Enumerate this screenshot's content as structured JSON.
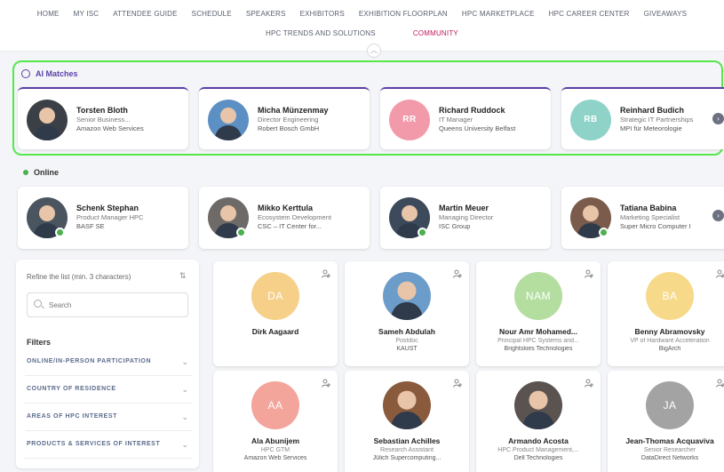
{
  "nav": {
    "row1": [
      "Home",
      "MY ISC",
      "ATTENDEE GUIDE",
      "SCHEDULE",
      "SPEAKERS",
      "EXHIBITORS",
      "EXHIBITION FLOORPLAN",
      "HPC MARKETPLACE",
      "HPC CAREER CENTER",
      "GIVEAWAYS"
    ],
    "row2": [
      "HPC TRENDS AND SOLUTIONS",
      "COMMUNITY"
    ],
    "active": "COMMUNITY",
    "active_color": "#c2185b"
  },
  "ai_matches": {
    "title": "AI Matches",
    "highlight_color": "#55e84b",
    "people": [
      {
        "name": "Torsten Bloth",
        "role": "Senior Business...",
        "org": "Amazon Web Services",
        "initials": "",
        "avatar_color": "#3b3f46",
        "photo": true
      },
      {
        "name": "Micha Münzenmay",
        "role": "Director Engineering",
        "org": "Robert Bosch GmbH",
        "initials": "",
        "avatar_color": "#5c8fc4",
        "photo": true
      },
      {
        "name": "Richard Ruddock",
        "role": "IT Manager",
        "org": "Queens University Belfast",
        "initials": "RR",
        "avatar_color": "#f29aa9",
        "photo": false
      },
      {
        "name": "Reinhard Budich",
        "role": "Strategic IT Partnerships",
        "org": "MPI für Meteorologie",
        "initials": "RB",
        "avatar_color": "#8fd3c8",
        "photo": false
      }
    ]
  },
  "online": {
    "title": "Online",
    "people": [
      {
        "name": "Schenk Stephan",
        "role": "Product Manager HPC",
        "org": "BASF SE",
        "initials": "",
        "avatar_color": "#4a5560",
        "photo": true
      },
      {
        "name": "Mikko Kerttula",
        "role": "Ecosystem Development",
        "org": "CSC – IT Center for...",
        "initials": "",
        "avatar_color": "#6d6a68",
        "photo": true
      },
      {
        "name": "Martin Meuer",
        "role": "Managing Director",
        "org": "ISC Group",
        "initials": "",
        "avatar_color": "#3c4a5c",
        "photo": true
      },
      {
        "name": "Tatiana Babina",
        "role": "Marketing Specialist",
        "org": "Super Micro Computer I",
        "initials": "",
        "avatar_color": "#7a5b4c",
        "photo": true
      }
    ]
  },
  "filters": {
    "refine_label": "Refine the list (min. 3 characters)",
    "search_placeholder": "Search",
    "heading": "Filters",
    "items": [
      "ONLINE/IN-PERSON PARTICIPATION",
      "COUNTRY OF RESIDENCE",
      "AREAS OF HPC INTEREST",
      "PRODUCTS & SERVICES OF INTEREST"
    ]
  },
  "grid": [
    {
      "name": "Dirk Aagaard",
      "role": "",
      "org": "",
      "initials": "DA",
      "avatar_color": "#f6cf88",
      "photo": false
    },
    {
      "name": "Sameh Abdulah",
      "role": "Postdoc",
      "org": "KAUST",
      "initials": "",
      "avatar_color": "#6c9cc9",
      "photo": true
    },
    {
      "name": "Nour Amr Mohamed...",
      "role": "Principal HPC Systems and...",
      "org": "Brightskies Technologies",
      "initials": "NAM",
      "avatar_color": "#b3dea0",
      "photo": false
    },
    {
      "name": "Benny Abramovsky",
      "role": "VP of Hardware Acceleration",
      "org": "BigArch",
      "initials": "BA",
      "avatar_color": "#f7d98a",
      "photo": false
    },
    {
      "name": "Ala Abunijem",
      "role": "HPC GTM",
      "org": "Amazon Web Services",
      "initials": "AA",
      "avatar_color": "#f3a49b",
      "photo": false
    },
    {
      "name": "Sebastian Achilles",
      "role": "Research Assistant",
      "org": "Jülich Supercomputing...",
      "initials": "",
      "avatar_color": "#8a5a3c",
      "photo": true
    },
    {
      "name": "Armando Acosta",
      "role": "HPC Product Management,...",
      "org": "Dell Technologies",
      "initials": "",
      "avatar_color": "#5b5350",
      "photo": true
    },
    {
      "name": "Jean-Thomas Acquaviva",
      "role": "Senior Researcher",
      "org": "DataDirect Networks",
      "initials": "JA",
      "avatar_color": "#a3a3a3",
      "photo": false
    }
  ]
}
